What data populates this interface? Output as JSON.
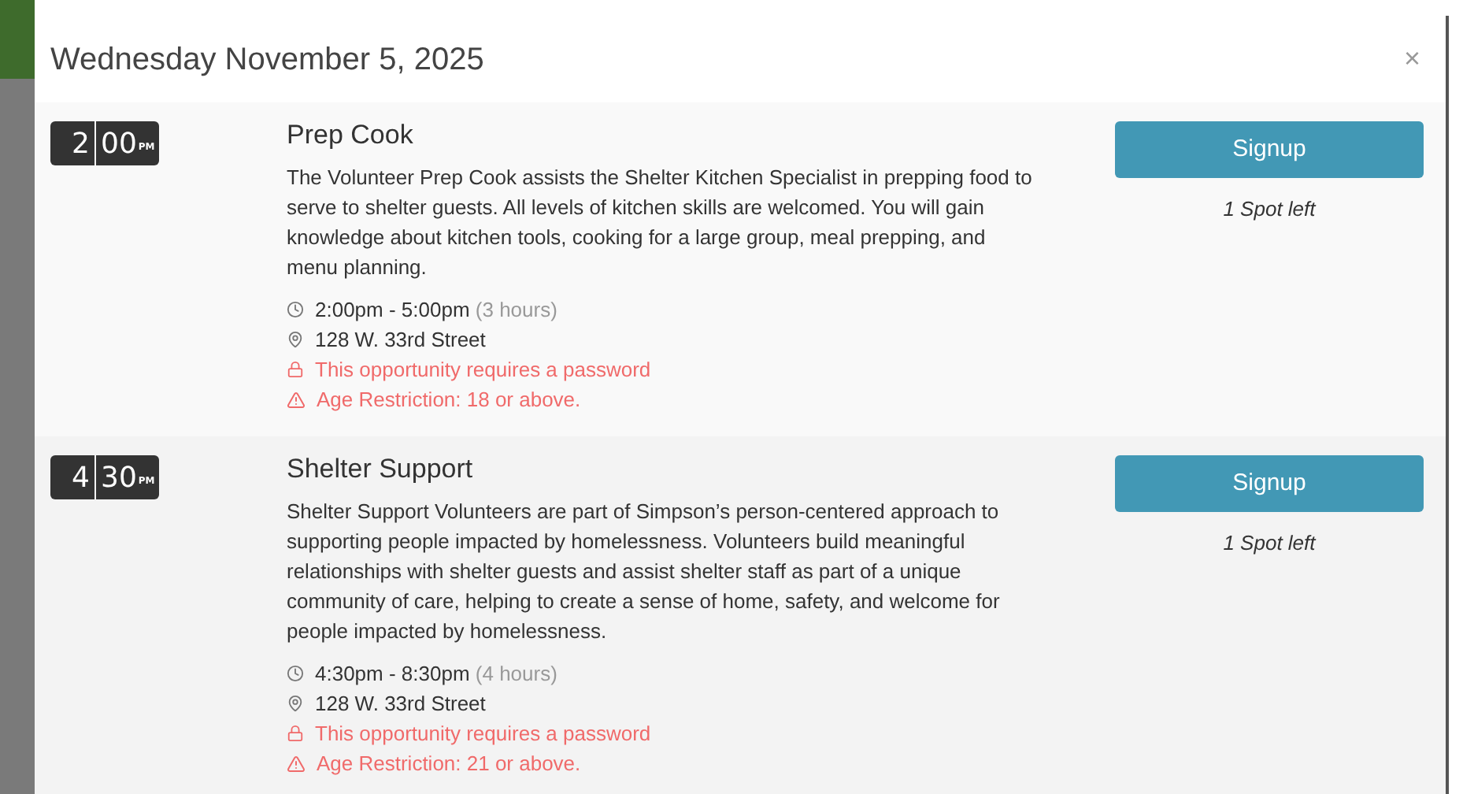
{
  "modal": {
    "title": "Wednesday November 5, 2025",
    "close": "×"
  },
  "opportunities": [
    {
      "time": {
        "hour": "2",
        "minute": "00",
        "period": "PM"
      },
      "title": "Prep Cook",
      "description": "The Volunteer Prep Cook assists the Shelter Kitchen Specialist in prepping food to serve to shelter guests. All levels of kitchen skills are welcomed. You will gain knowledge about kitchen tools, cooking for a large group, meal prepping, and menu planning.",
      "time_range": "2:00pm - 5:00pm",
      "duration": "(3 hours)",
      "location": "128 W. 33rd Street",
      "password_notice": "This opportunity requires a password",
      "age_restriction": "Age Restriction: 18 or above.",
      "button": "Signup",
      "spots": "1 Spot left"
    },
    {
      "time": {
        "hour": "4",
        "minute": "30",
        "period": "PM"
      },
      "title": "Shelter Support",
      "description": "Shelter Support Volunteers are part of Simpson’s person-centered approach to supporting people impacted by homelessness. Volunteers build meaningful relationships with shelter guests and assist shelter staff as part of a unique community of care, helping to create a sense of home, safety, and welcome for people impacted by homelessness.",
      "time_range": "4:30pm - 8:30pm",
      "duration": "(4 hours)",
      "location": "128 W. 33rd Street",
      "password_notice": "This opportunity requires a password",
      "age_restriction": "Age Restriction: 21 or above.",
      "button": "Signup",
      "spots": "1 Spot left"
    }
  ]
}
